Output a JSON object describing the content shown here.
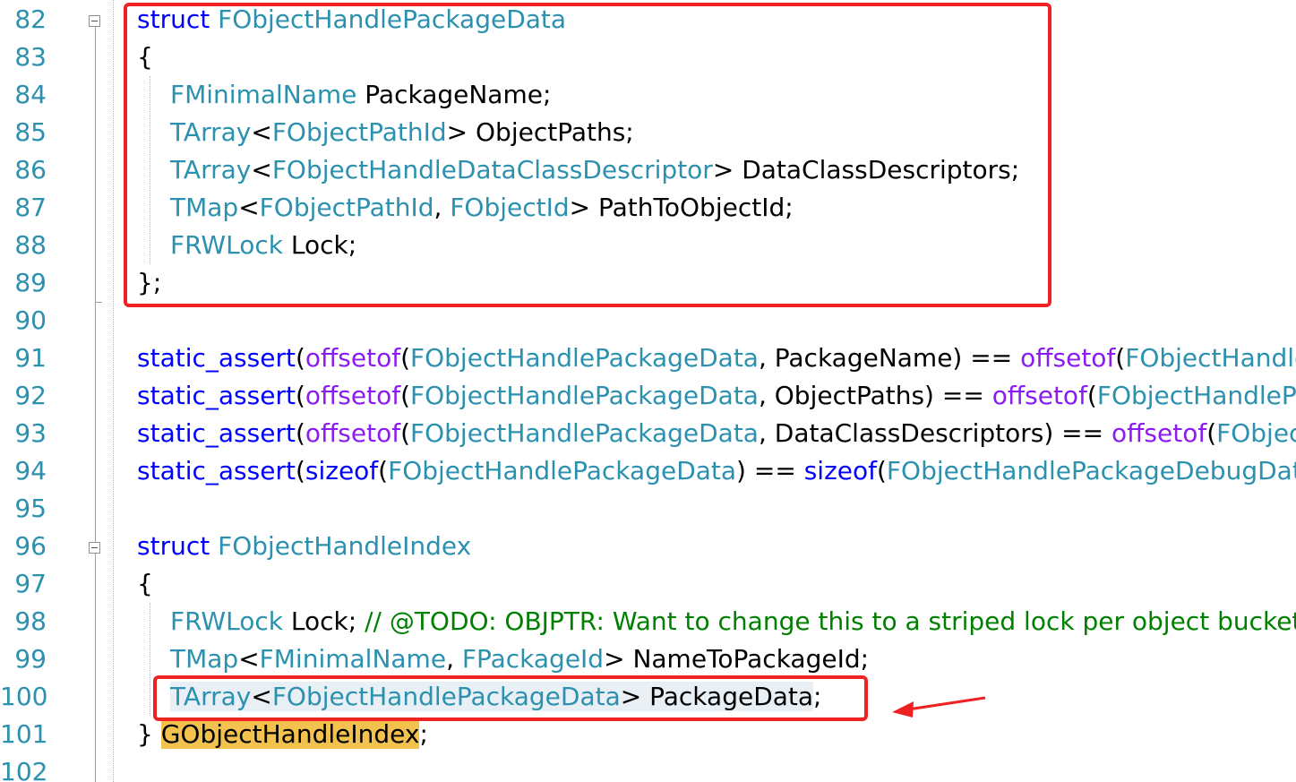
{
  "line_numbers": [
    "82",
    "83",
    "84",
    "85",
    "86",
    "87",
    "88",
    "89",
    "90",
    "91",
    "92",
    "93",
    "94",
    "95",
    "96",
    "97",
    "98",
    "99",
    "100",
    "101",
    "102"
  ],
  "code": {
    "l82": {
      "kw": "struct",
      "name": "FObjectHandlePackageData"
    },
    "l83": {
      "brace": "{"
    },
    "l84": {
      "type": "FMinimalName",
      "rest": " PackageName;"
    },
    "l85": {
      "type": "TArray",
      "lt": "<",
      "arg": "FObjectPathId",
      "rest": "> ObjectPaths;"
    },
    "l86": {
      "type": "TArray",
      "lt": "<",
      "arg": "FObjectHandleDataClassDescriptor",
      "rest": "> DataClassDescriptors;"
    },
    "l87": {
      "type": "TMap",
      "lt": "<",
      "arg1": "FObjectPathId",
      "sep": ", ",
      "arg2": "FObjectId",
      "rest": "> PathToObjectId;"
    },
    "l88": {
      "type": "FRWLock",
      "rest": " Lock;"
    },
    "l89": {
      "brace": "};"
    },
    "l91": {
      "kw": "static_assert",
      "p1": "(",
      "fn": "offsetof",
      "p2": "(",
      "ty": "FObjectHandlePackageData",
      "mid": ", PackageName) == ",
      "fn2": "offsetof",
      "p3": "(",
      "ty2": "FObjectHandlePackageDebugData"
    },
    "l92": {
      "kw": "static_assert",
      "p1": "(",
      "fn": "offsetof",
      "p2": "(",
      "ty": "FObjectHandlePackageData",
      "mid": ", ObjectPaths) == ",
      "fn2": "offsetof",
      "p3": "(",
      "ty2": "FObjectHandlePackageDebugData"
    },
    "l93": {
      "kw": "static_assert",
      "p1": "(",
      "fn": "offsetof",
      "p2": "(",
      "ty": "FObjectHandlePackageData",
      "mid": ", DataClassDescriptors) == ",
      "fn2": "offsetof",
      "p3": "(",
      "ty2": "FObjectHandlePackageDebugData"
    },
    "l94": {
      "kw": "static_assert",
      "p1": "(",
      "fn": "sizeof",
      "p2": "(",
      "ty": "FObjectHandlePackageData",
      "mid": ") == ",
      "fn2": "sizeof",
      "p3": "(",
      "ty2": "FObjectHandlePackageDebugData"
    },
    "l96": {
      "kw": "struct",
      "name": "FObjectHandleIndex"
    },
    "l97": {
      "brace": "{"
    },
    "l98": {
      "type": "FRWLock",
      "rest": " Lock; ",
      "comment": "// @TODO: OBJPTR: Want to change this to a striped lock per object bucket"
    },
    "l99": {
      "type": "TMap",
      "lt": "<",
      "arg1": "FMinimalName",
      "sep": ", ",
      "arg2": "FPackageId",
      "rest": "> NameToPackageId;"
    },
    "l100": {
      "type": "TArray",
      "lt": "<",
      "arg": "FObjectHandlePackageData",
      "rest": "> PackageData",
      "semi": ";"
    },
    "l101": {
      "brace": "} ",
      "name": "GObjectHandleIndex",
      "semi": ";"
    }
  },
  "annotations": {
    "box_color": "#ee2222",
    "arrow_color": "#ee2222"
  }
}
